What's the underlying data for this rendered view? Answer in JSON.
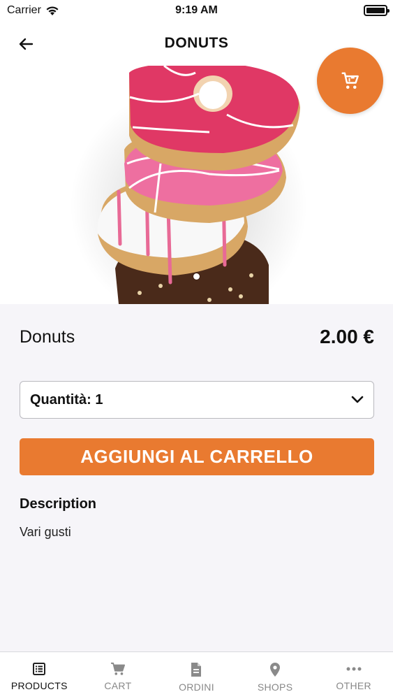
{
  "status_bar": {
    "carrier": "Carrier",
    "time": "9:19 AM"
  },
  "nav": {
    "title": "DONUTS"
  },
  "colors": {
    "accent": "#e97a30",
    "icon_active": "#222222",
    "icon_inactive": "#8a8a8a"
  },
  "product": {
    "name": "Donuts",
    "price": "2.00 €",
    "quantity_label": "Quantità: 1",
    "add_button_label": "AGGIUNGI AL CARRELLO",
    "description_title": "Description",
    "description_text": "Vari gusti"
  },
  "icons": {
    "back": "arrow-left-icon",
    "cart_fab": "cart-icon",
    "dropdown": "chevron-down-icon"
  },
  "tabs": [
    {
      "label": "PRODUCTS",
      "icon": "list-icon",
      "active": true
    },
    {
      "label": "CART",
      "icon": "cart-icon",
      "active": false
    },
    {
      "label": "ORDINI",
      "icon": "document-icon",
      "active": false
    },
    {
      "label": "SHOPS",
      "icon": "location-pin-icon",
      "active": false
    },
    {
      "label": "OTHER",
      "icon": "more-horizontal-icon",
      "active": false
    }
  ]
}
